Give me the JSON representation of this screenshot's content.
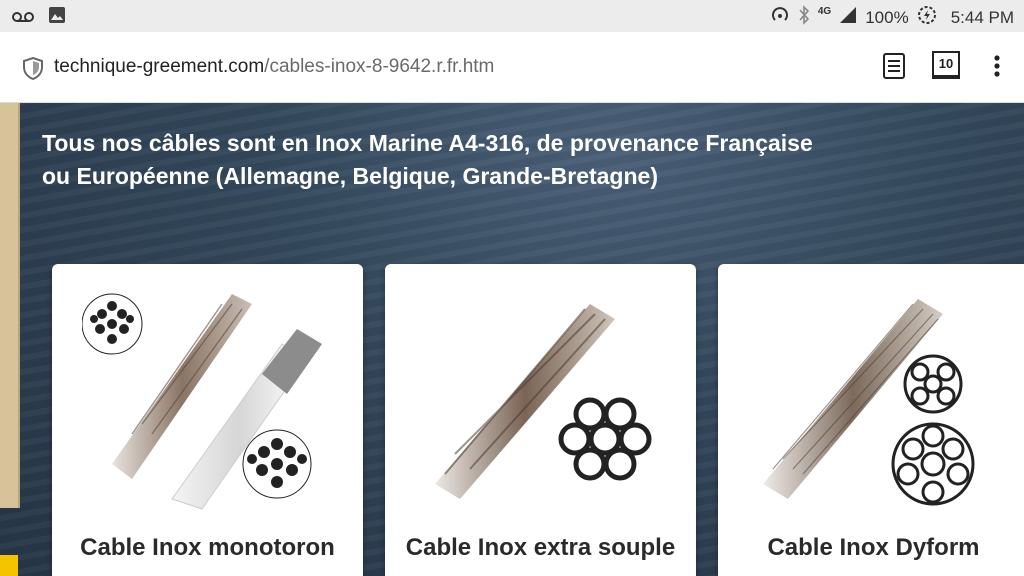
{
  "status_bar": {
    "battery": "100%",
    "time": "5:44 PM",
    "network": "4G",
    "left_icons": [
      "voicemail-icon",
      "image-icon"
    ],
    "right_icons": [
      "hotspot-icon",
      "bluetooth-icon",
      "signal-icon",
      "battery-saver-icon"
    ]
  },
  "browser": {
    "url_domain": "technique-greement.com",
    "url_path": "/cables-inox-8-9642.r.fr.htm",
    "tab_count": "10"
  },
  "page": {
    "headline_line1": "Tous nos câbles sont en Inox Marine A4-316, de provenance Française",
    "headline_line2": "ou Européenne (Allemagne, Belgique, Grande-Bretagne)",
    "products": [
      {
        "title": "Cable Inox monotoron"
      },
      {
        "title": "Cable Inox extra souple"
      },
      {
        "title": "Cable Inox Dyform"
      }
    ]
  }
}
